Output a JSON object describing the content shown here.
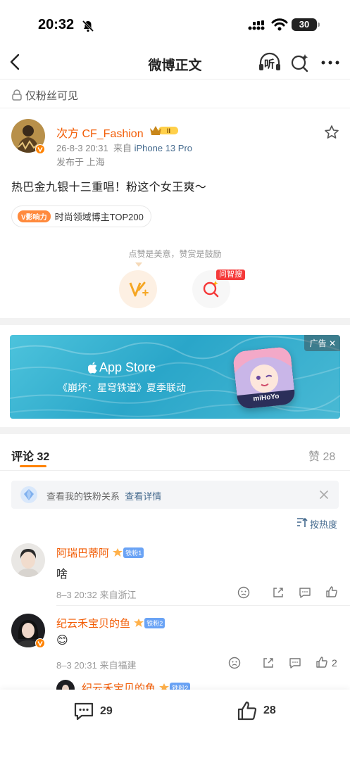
{
  "status_bar": {
    "time": "20:32",
    "battery": "30"
  },
  "header": {
    "title": "微博正文",
    "listen_label": "听"
  },
  "post": {
    "visibility": "仅粉丝可见",
    "author": "次方 CF_Fashion",
    "date": "26-8-3 20:31",
    "source_prefix": "来自",
    "device": "iPhone 13 Pro",
    "location": "发布于 上海",
    "text": "热巴金九银十三重唱！粉这个女王爽～",
    "influence_badge": "V影响力",
    "influence_label": "时尚领域博主TOP200",
    "like_hint": "点赞是美意，赞赏是鼓励",
    "wenzhi_tag": "问智搜"
  },
  "ad": {
    "tag": "广告 ✕",
    "store": "App Store",
    "text": "《崩坏：星穹铁道》夏季联动",
    "game_icon_text": "miHoYo"
  },
  "tabs": {
    "comments_label": "评论",
    "comments_count": "32",
    "likes_label": "赞",
    "likes_count": "28"
  },
  "fan_banner": {
    "text": "查看我的铁粉关系",
    "link": "查看详情"
  },
  "sort_label": "按热度",
  "comments": [
    {
      "name": "阿瑞巴蒂阿",
      "badge": "铁粉1",
      "text": "啥",
      "meta": "8–3 20:32  来自浙江",
      "likes": ""
    },
    {
      "name": "纪云禾宝贝的鱼",
      "badge": "铁粉2",
      "text": "😊",
      "meta": "8–3 20:31  来自福建",
      "likes": "2"
    },
    {
      "name": "纪云禾宝贝的鱼",
      "badge": "铁粉2"
    }
  ],
  "bottom_bar": {
    "comment_count": "29",
    "like_count": "28"
  },
  "colors": {
    "accent": "#ff8200",
    "username": "#f25c05",
    "link": "#43698d"
  }
}
